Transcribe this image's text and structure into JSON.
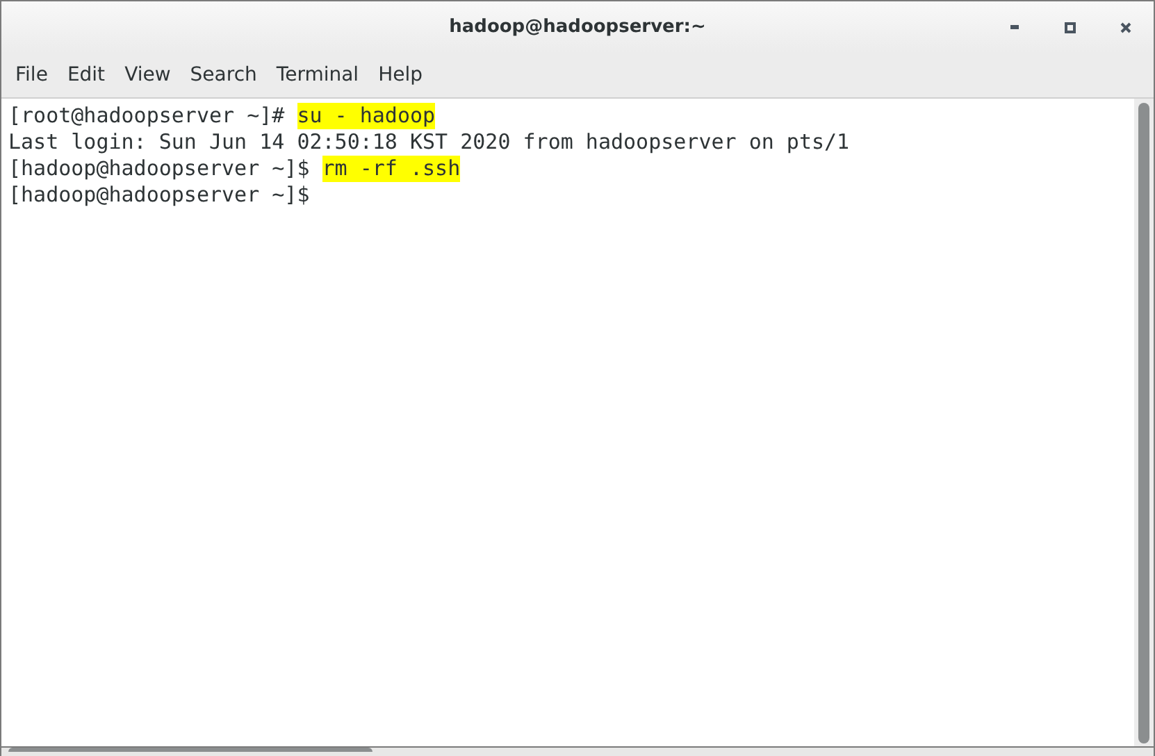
{
  "window": {
    "title": "hadoop@hadoopserver:~"
  },
  "menu": [
    "File",
    "Edit",
    "View",
    "Search",
    "Terminal",
    "Help"
  ],
  "terminal": {
    "lines": [
      [
        {
          "text": "[root@hadoopserver ~]# ",
          "highlighted": false
        },
        {
          "text": "su - hadoop",
          "highlighted": true
        }
      ],
      [
        {
          "text": "Last login: Sun Jun 14 02:50:18 KST 2020 from hadoopserver on pts/1",
          "highlighted": false
        }
      ],
      [
        {
          "text": "[hadoop@hadoopserver ~]$ ",
          "highlighted": false
        },
        {
          "text": "rm -rf .ssh",
          "highlighted": true
        }
      ],
      [
        {
          "text": "[hadoop@hadoopserver ~]$",
          "highlighted": false
        }
      ]
    ]
  }
}
